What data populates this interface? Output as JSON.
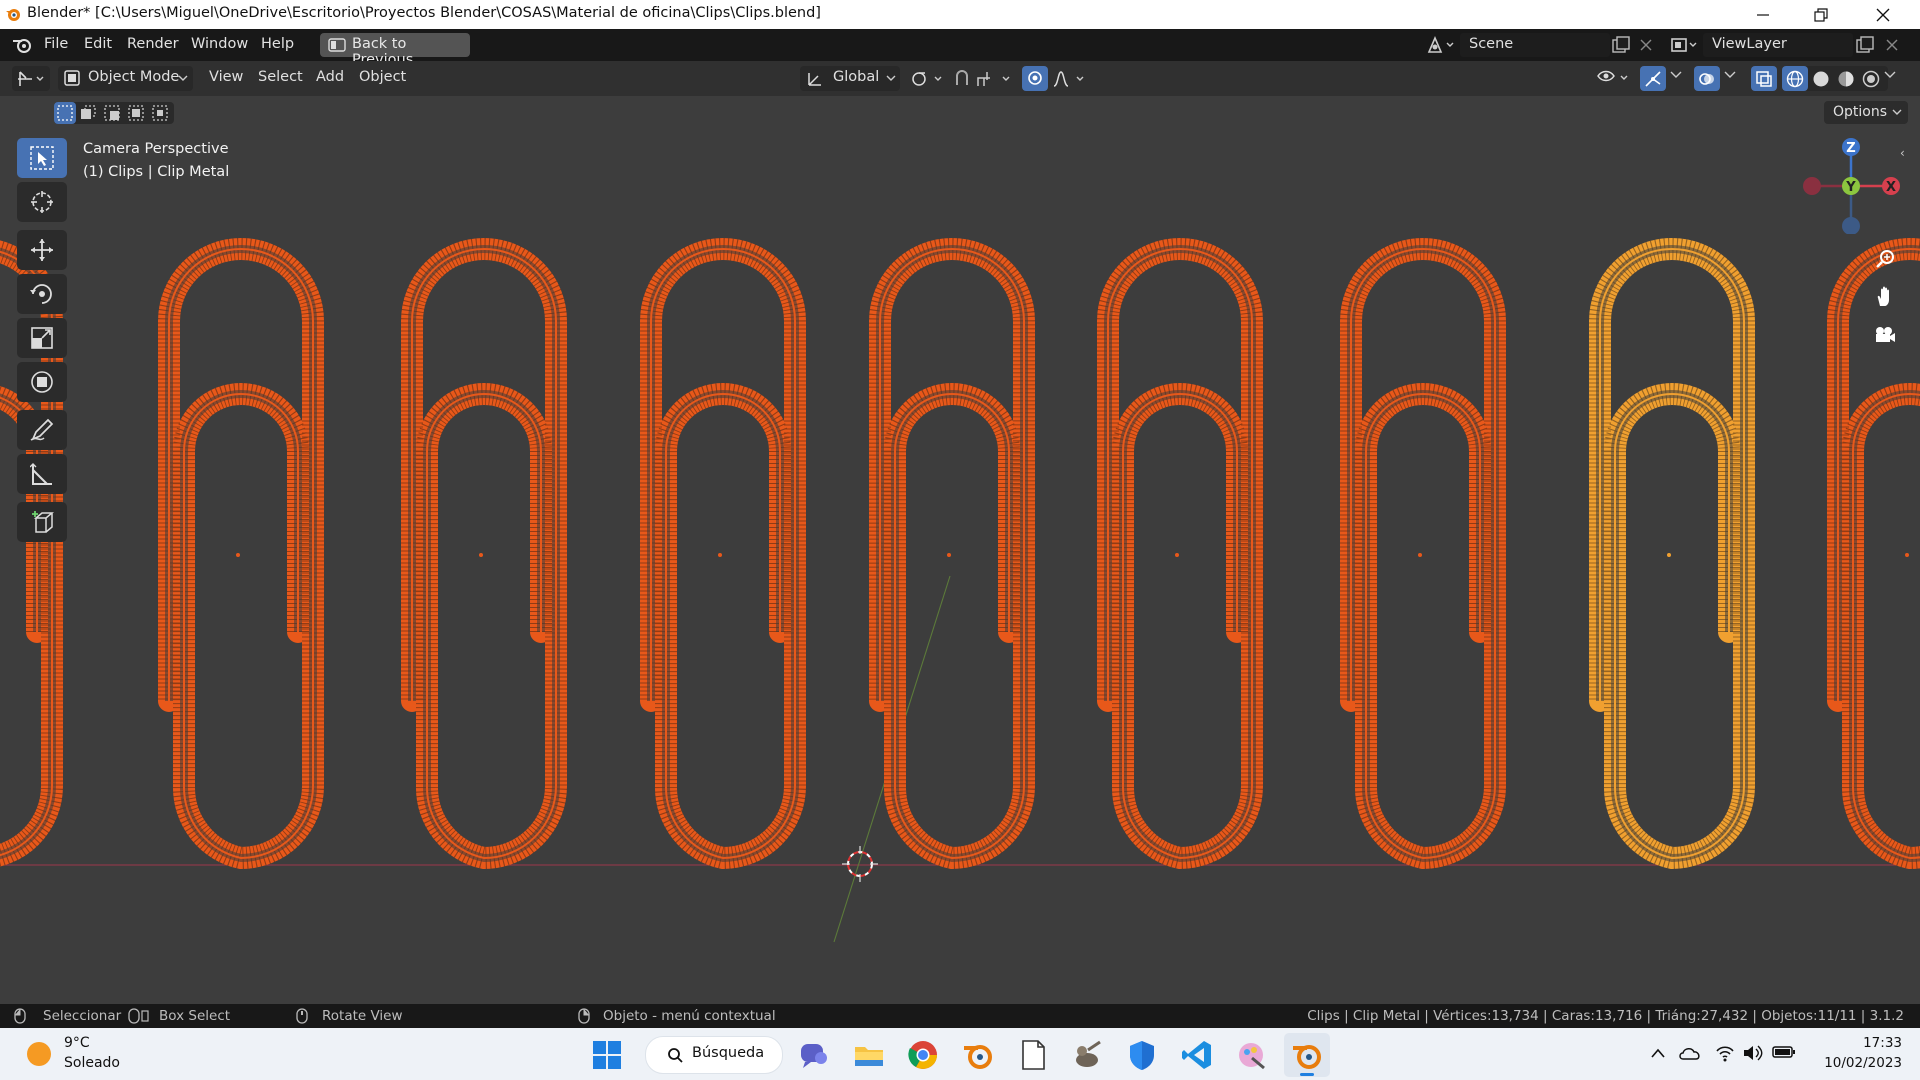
{
  "window": {
    "title": "Blender* [C:\\Users\\Miguel\\OneDrive\\Escritorio\\Proyectos Blender\\COSAS\\Material de oficina\\Clips\\Clips.blend]"
  },
  "topbar": {
    "menus": [
      "File",
      "Edit",
      "Render",
      "Window",
      "Help"
    ],
    "back_button": "Back to Previous",
    "scene": "Scene",
    "view_layer": "ViewLayer"
  },
  "header": {
    "mode": "Object Mode",
    "menus": [
      "View",
      "Select",
      "Add",
      "Object"
    ],
    "orientation": "Global",
    "options": "Options"
  },
  "viewport": {
    "view_name": "Camera Perspective",
    "object_info": "(1) Clips | Clip Metal",
    "gizmo_axes": [
      "Z",
      "Y",
      "X"
    ],
    "wire_color": "#e8581a",
    "selected_wire_color": "#f0a030",
    "background": "#3d3d3d"
  },
  "statusbar": {
    "select": "Seleccionar",
    "box_select": "Box Select",
    "rotate": "Rotate View",
    "context": "Objeto - menú contextual",
    "stats": "Clips | Clip Metal | Vértices:13,734 | Caras:13,716 | Triáng:27,432 | Objetos:11/11 | 3.1.2"
  },
  "taskbar": {
    "temperature": "9°C",
    "weather": "Soleado",
    "search": "Búsqueda",
    "time": "17:33",
    "date": "10/02/2023"
  }
}
